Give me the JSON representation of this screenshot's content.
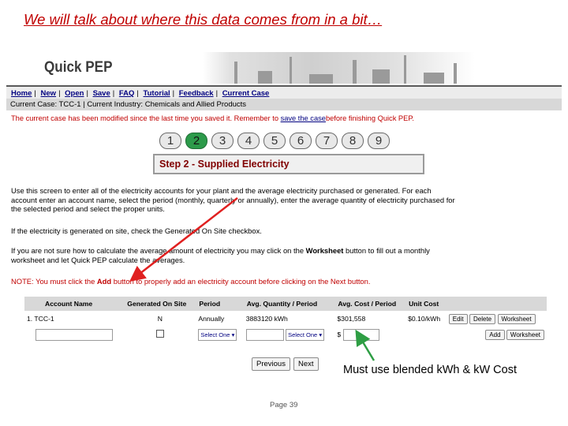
{
  "slide": {
    "title": "We will talk about where this data comes from in a bit…",
    "callout": "Must use blended kWh & kW Cost",
    "page_number": "Page 39"
  },
  "app": {
    "logo": "Quick PEP"
  },
  "nav": {
    "items": [
      "Home",
      "New",
      "Open",
      "Save",
      "FAQ",
      "Tutorial",
      "Feedback",
      "Current Case"
    ],
    "separator": "|"
  },
  "case_bar": "Current Case: TCC-1 | Current Industry: Chemicals and Allied Products",
  "warning": {
    "prefix": "The current case has been modified since the last time you saved it. Remember to ",
    "link": "save the case",
    "suffix": "before finishing Quick PEP."
  },
  "steps": {
    "numbers": [
      "1",
      "2",
      "3",
      "4",
      "5",
      "6",
      "7",
      "8",
      "9"
    ],
    "active_index": 1
  },
  "step_title": "Step 2 - Supplied Electricity",
  "instructions": {
    "p1_line1": "Use this screen to enter all of the electricity accounts for your plant and the average electricity purchased or generated. For each",
    "p1_line2": "account enter an account name, select the period (monthly, quarterly or annually), enter the average quantity of electricity purchased for",
    "p1_line3": "the selected period and select the proper units.",
    "p2": "If the electricity is generated on site, check the Generated On Site checkbox.",
    "p3_line1_pre": "If you are not sure how to calculate the average amount of electricity you may click on the ",
    "p3_bold": "Worksheet",
    "p3_line1_post": " button to fill out a monthly",
    "p3_line2": "worksheet and let Quick PEP calculate the averages.",
    "note_pre": "NOTE: You must click the ",
    "note_bold": "Add",
    "note_post": " button to properly add an electricity account before clicking on the Next button."
  },
  "table": {
    "headers": [
      "Account Name",
      "Generated On Site",
      "Period",
      "Avg. Quantity / Period",
      "Avg. Cost / Period",
      "Unit Cost"
    ],
    "row": {
      "index": "1.",
      "account": "TCC-1",
      "generated": "N",
      "period": "Annually",
      "quantity": "3883120",
      "quantity_unit": "kWh",
      "cost": "$301,558",
      "unit_cost": "$0.10/kWh",
      "edit": "Edit",
      "delete": "Delete",
      "worksheet": "Worksheet"
    },
    "new_row": {
      "period_select": "Select One",
      "unit_select": "Select One",
      "currency": "$",
      "add": "Add",
      "worksheet": "Worksheet"
    }
  },
  "buttons": {
    "previous": "Previous",
    "next": "Next"
  },
  "colors": {
    "title_red": "#c00000",
    "arrow_red": "#e02020",
    "arrow_green": "#2e9e44",
    "active_step": "#2c9a4a"
  }
}
